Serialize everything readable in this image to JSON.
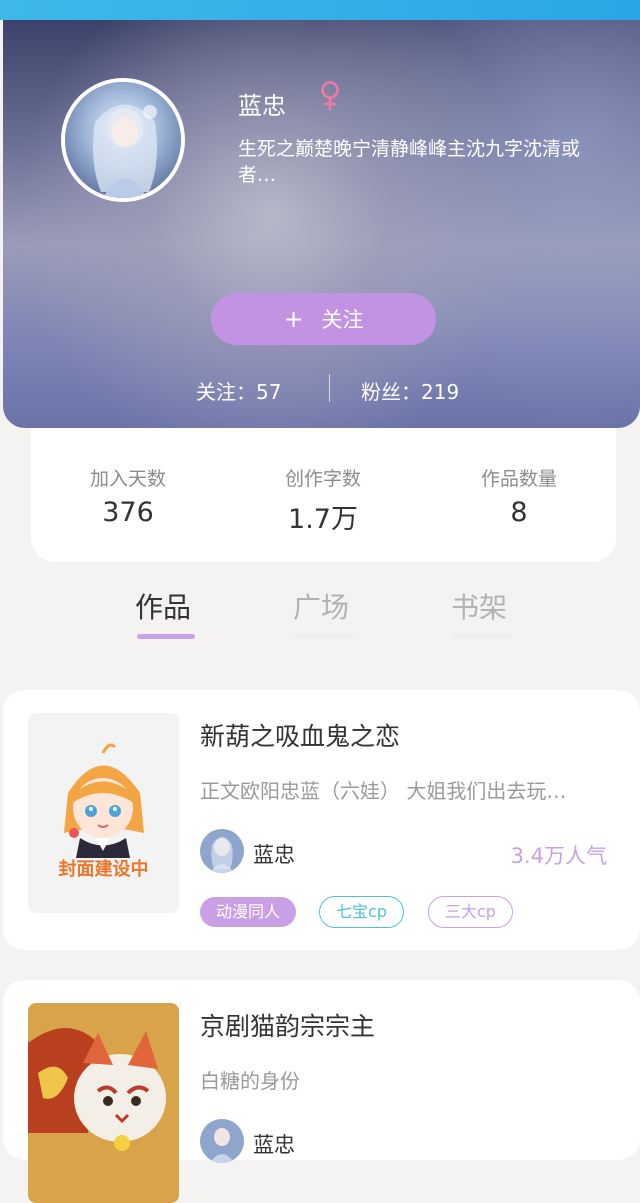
{
  "profile": {
    "name": "蓝忠",
    "gender_icon": "female-symbol-icon",
    "bio": "生死之巅楚晚宁清静峰峰主沈九字沈清或者…",
    "follow_label": "关注",
    "follow_icon": "+",
    "following_label": "关注：57",
    "followers_label": "粉丝：219",
    "accent_color": "#c293e3"
  },
  "stats": [
    {
      "label": "加入天数",
      "value": "376"
    },
    {
      "label": "创作字数",
      "value": "1.7万"
    },
    {
      "label": "作品数量",
      "value": "8"
    }
  ],
  "tabs": [
    {
      "label": "作品",
      "active": true
    },
    {
      "label": "广场",
      "active": false
    },
    {
      "label": "书架",
      "active": false
    }
  ],
  "works": [
    {
      "title": "新葫之吸血鬼之恋",
      "excerpt": "正文欧阳忠蓝（六娃） 大姐我们出去玩…",
      "author": "蓝忠",
      "popularity": "3.4万人气",
      "cover_text": "封面建设中",
      "tags": [
        "动漫同人",
        "七宝cp",
        "三大cp"
      ]
    },
    {
      "title": "京剧猫韵宗宗主",
      "excerpt": "白糖的身份",
      "author": "蓝忠",
      "popularity": "",
      "cover_text": "",
      "tags": []
    }
  ]
}
